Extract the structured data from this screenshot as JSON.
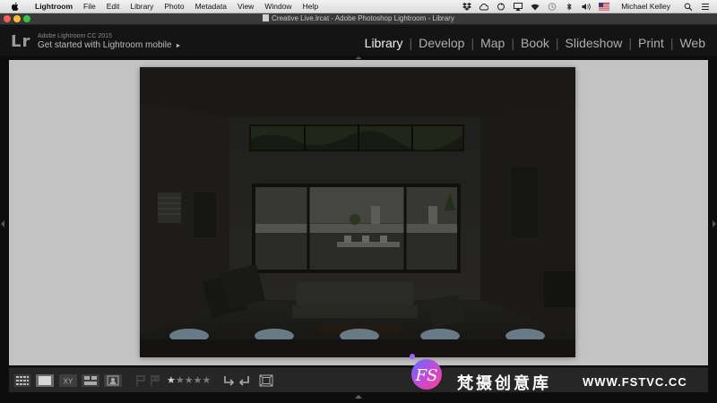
{
  "menubar": {
    "app_name": "Lightroom",
    "menus": [
      "File",
      "Edit",
      "Library",
      "Photo",
      "Metadata",
      "View",
      "Window",
      "Help"
    ],
    "user": "Michael Kelley",
    "status_icons": [
      "dropbox-icon",
      "creative-cloud-icon",
      "sync-icon",
      "airplay-icon",
      "wifi-icon",
      "time-machine-icon",
      "bluetooth-icon",
      "volume-icon",
      "flag-icon"
    ]
  },
  "window": {
    "title": "Creative Live.lrcat - Adobe Photoshop Lightroom - Library",
    "traffic_colors": [
      "#fc5f57",
      "#fdbc2e",
      "#33c748"
    ]
  },
  "identity_plate": {
    "logo": "Lr",
    "product": "Adobe Lightroom CC 2015",
    "mobile_prompt": "Get started with Lightroom mobile",
    "mobile_arrow": "►"
  },
  "modules": {
    "items": [
      "Library",
      "Develop",
      "Map",
      "Book",
      "Slideshow",
      "Print",
      "Web"
    ],
    "active": "Library"
  },
  "toolbar": {
    "view_icons": [
      "grid-view-icon",
      "loupe-view-icon",
      "compare-view-icon",
      "survey-view-icon",
      "people-view-icon"
    ],
    "compare_label": "XY",
    "rating_label": "★★★★★",
    "rating_stars": 1,
    "rating_max": 5
  },
  "watermark": {
    "logo_text": "FS",
    "text": "梵摄创意库",
    "url": "WWW.FSTVC.CC"
  }
}
